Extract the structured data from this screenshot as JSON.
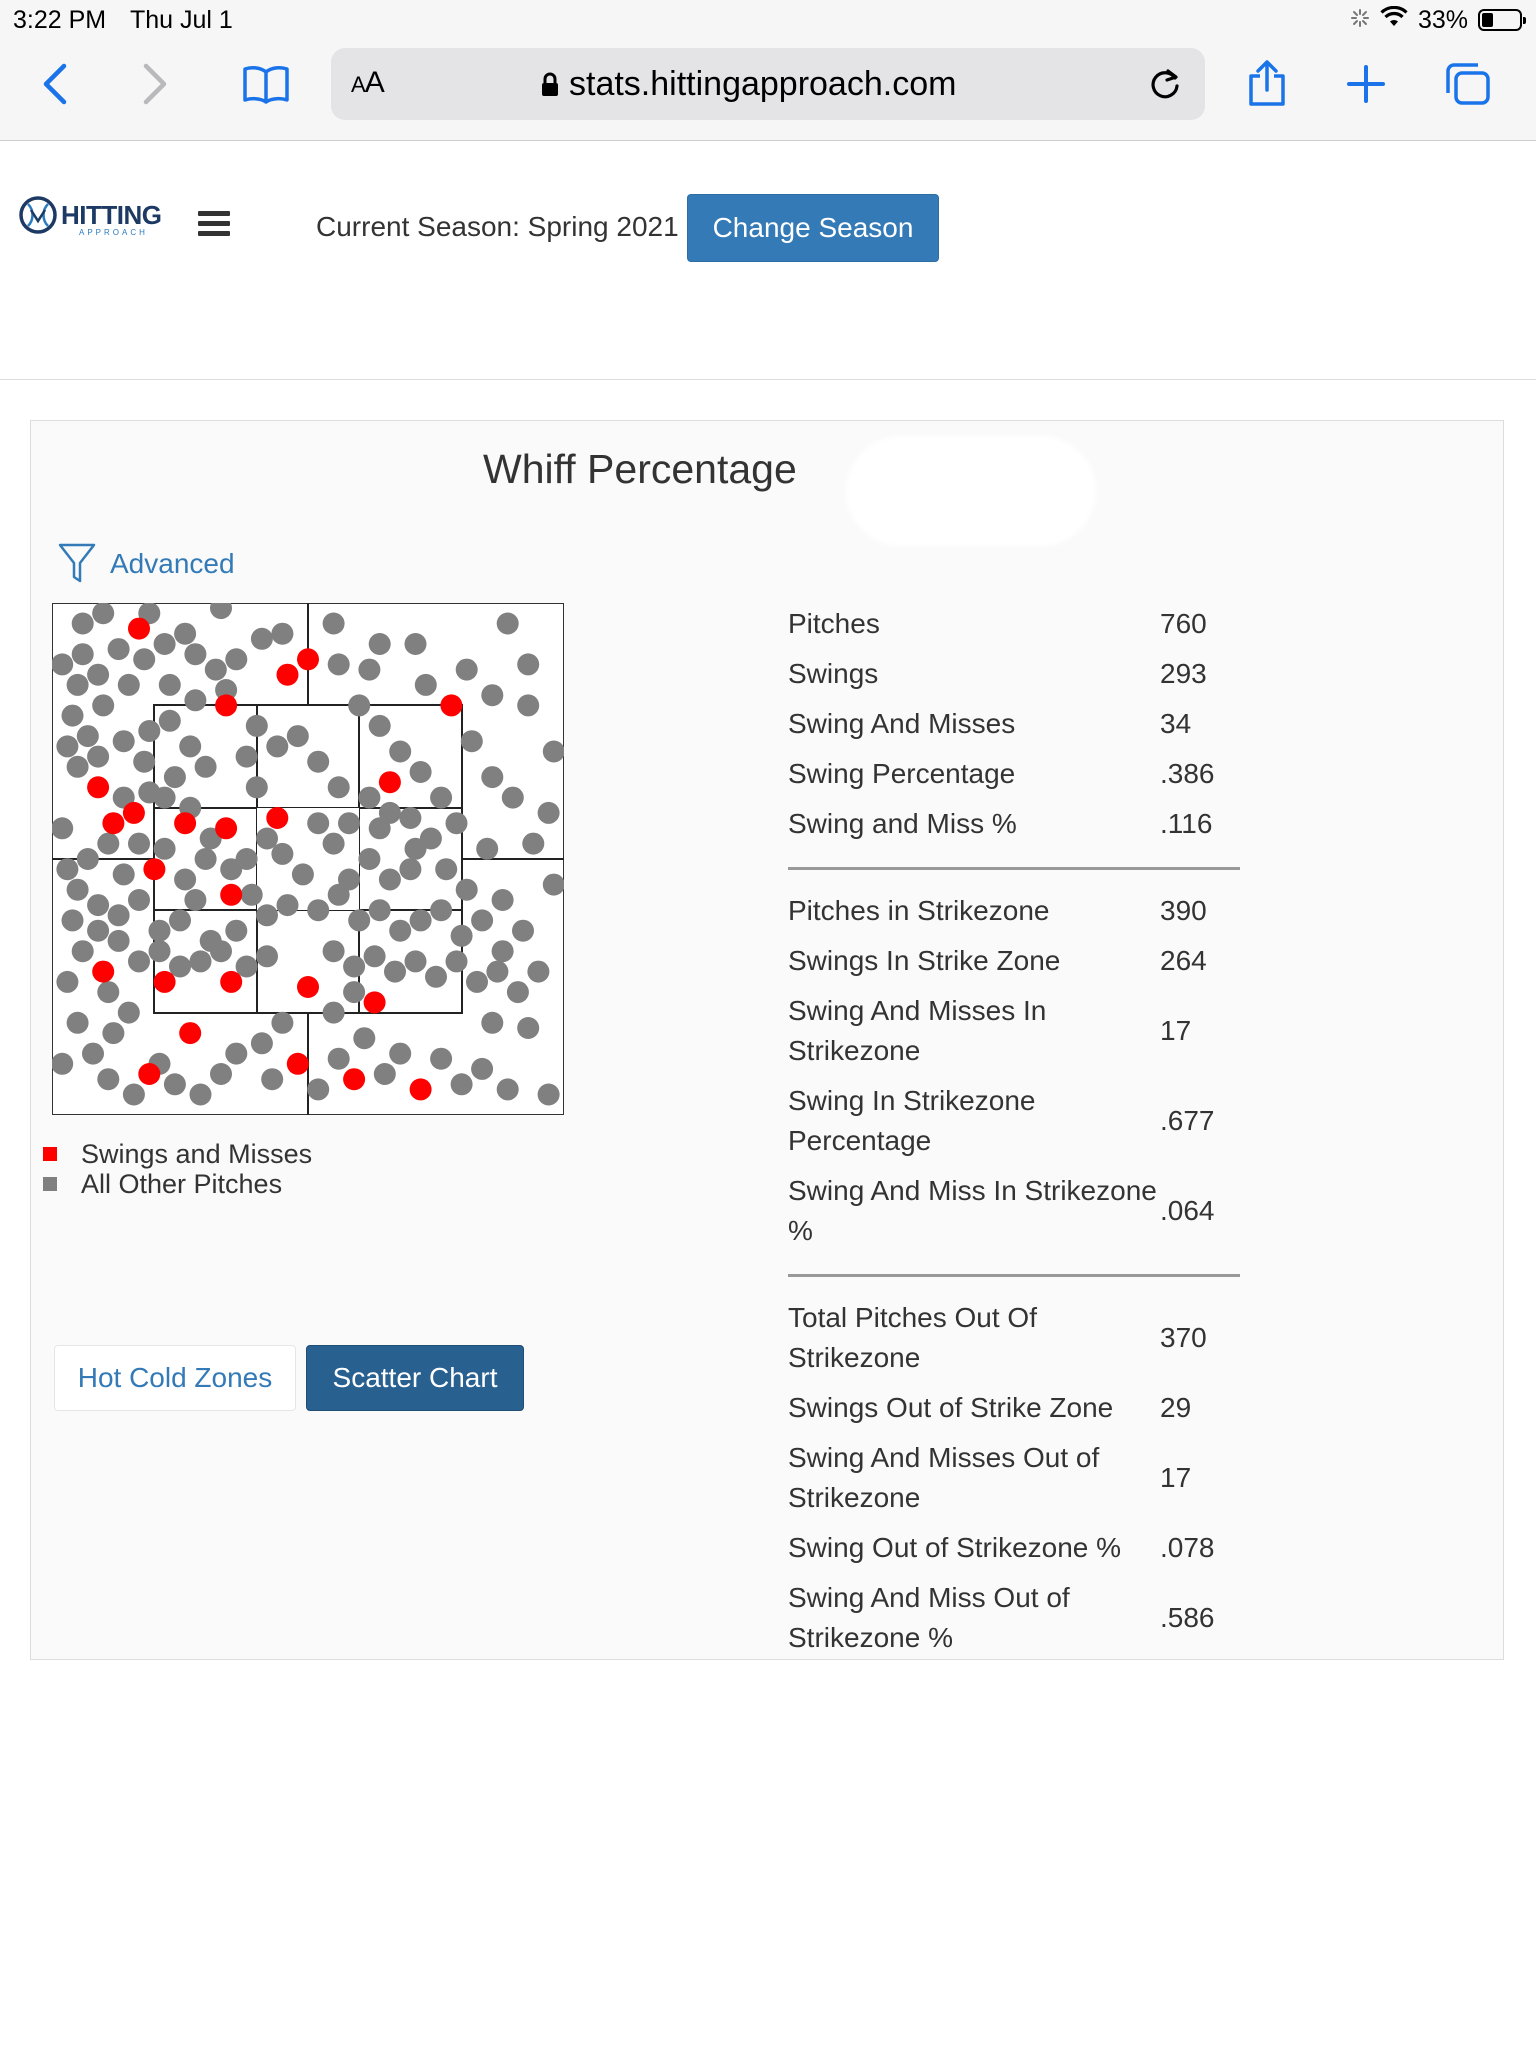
{
  "status_bar": {
    "time": "3:22 PM",
    "date": "Thu Jul 1",
    "battery": "33%"
  },
  "browser": {
    "text_size_label_small": "A",
    "text_size_label_large": "A",
    "url": "stats.hittingapproach.com"
  },
  "site": {
    "logo_text": "HITTING",
    "logo_subtext": "APPROACH",
    "season_text": "Current Season: Spring 2021",
    "change_season_label": "Change Season"
  },
  "panel": {
    "title": "Whiff Percentage",
    "advanced_label": "Advanced",
    "buttons": {
      "hot_cold": "Hot Cold Zones",
      "scatter": "Scatter Chart"
    }
  },
  "chart_data": {
    "type": "scatter",
    "legend": [
      "Swings and Misses",
      "All Other Pitches"
    ],
    "colors": {
      "swing_miss": "#ff0000",
      "other": "#808080"
    },
    "zone_grid": "3x3 strike zone inside 4 outer quadrants",
    "series": [
      {
        "name": "Swings and Misses",
        "points": [
          [
            0.17,
            0.05
          ],
          [
            0.5,
            0.11
          ],
          [
            0.46,
            0.14
          ],
          [
            0.78,
            0.2
          ],
          [
            0.34,
            0.2
          ],
          [
            0.09,
            0.36
          ],
          [
            0.16,
            0.41
          ],
          [
            0.12,
            0.43
          ],
          [
            0.26,
            0.43
          ],
          [
            0.34,
            0.44
          ],
          [
            0.44,
            0.42
          ],
          [
            0.66,
            0.35
          ],
          [
            0.2,
            0.52
          ],
          [
            0.35,
            0.57
          ],
          [
            0.1,
            0.72
          ],
          [
            0.22,
            0.74
          ],
          [
            0.35,
            0.74
          ],
          [
            0.5,
            0.75
          ],
          [
            0.63,
            0.78
          ],
          [
            0.27,
            0.84
          ],
          [
            0.19,
            0.92
          ],
          [
            0.48,
            0.9
          ],
          [
            0.59,
            0.93
          ],
          [
            0.72,
            0.95
          ]
        ]
      },
      {
        "name": "All Other Pitches",
        "points": [
          [
            0.06,
            0.04
          ],
          [
            0.1,
            0.02
          ],
          [
            0.19,
            0.02
          ],
          [
            0.26,
            0.06
          ],
          [
            0.33,
            0.01
          ],
          [
            0.45,
            0.06
          ],
          [
            0.55,
            0.04
          ],
          [
            0.64,
            0.08
          ],
          [
            0.71,
            0.08
          ],
          [
            0.89,
            0.04
          ],
          [
            0.93,
            0.12
          ],
          [
            0.81,
            0.13
          ],
          [
            0.86,
            0.18
          ],
          [
            0.93,
            0.2
          ],
          [
            0.98,
            0.29
          ],
          [
            0.06,
            0.1
          ],
          [
            0.09,
            0.14
          ],
          [
            0.13,
            0.09
          ],
          [
            0.18,
            0.11
          ],
          [
            0.22,
            0.08
          ],
          [
            0.28,
            0.1
          ],
          [
            0.32,
            0.13
          ],
          [
            0.36,
            0.11
          ],
          [
            0.41,
            0.07
          ],
          [
            0.56,
            0.12
          ],
          [
            0.62,
            0.13
          ],
          [
            0.73,
            0.16
          ],
          [
            0.04,
            0.22
          ],
          [
            0.07,
            0.26
          ],
          [
            0.05,
            0.32
          ],
          [
            0.09,
            0.3
          ],
          [
            0.14,
            0.27
          ],
          [
            0.19,
            0.25
          ],
          [
            0.23,
            0.23
          ],
          [
            0.27,
            0.28
          ],
          [
            0.3,
            0.32
          ],
          [
            0.24,
            0.34
          ],
          [
            0.19,
            0.37
          ],
          [
            0.14,
            0.38
          ],
          [
            0.11,
            0.47
          ],
          [
            0.07,
            0.5
          ],
          [
            0.05,
            0.56
          ],
          [
            0.09,
            0.59
          ],
          [
            0.13,
            0.61
          ],
          [
            0.17,
            0.58
          ],
          [
            0.21,
            0.64
          ],
          [
            0.25,
            0.62
          ],
          [
            0.28,
            0.58
          ],
          [
            0.31,
            0.66
          ],
          [
            0.36,
            0.64
          ],
          [
            0.39,
            0.57
          ],
          [
            0.42,
            0.61
          ],
          [
            0.46,
            0.59
          ],
          [
            0.52,
            0.6
          ],
          [
            0.56,
            0.57
          ],
          [
            0.6,
            0.62
          ],
          [
            0.64,
            0.6
          ],
          [
            0.68,
            0.64
          ],
          [
            0.72,
            0.62
          ],
          [
            0.76,
            0.6
          ],
          [
            0.8,
            0.65
          ],
          [
            0.84,
            0.62
          ],
          [
            0.88,
            0.68
          ],
          [
            0.92,
            0.64
          ],
          [
            0.95,
            0.72
          ],
          [
            0.13,
            0.66
          ],
          [
            0.17,
            0.7
          ],
          [
            0.21,
            0.68
          ],
          [
            0.25,
            0.71
          ],
          [
            0.29,
            0.7
          ],
          [
            0.33,
            0.68
          ],
          [
            0.38,
            0.71
          ],
          [
            0.42,
            0.69
          ],
          [
            0.55,
            0.68
          ],
          [
            0.59,
            0.71
          ],
          [
            0.63,
            0.69
          ],
          [
            0.67,
            0.72
          ],
          [
            0.71,
            0.7
          ],
          [
            0.75,
            0.73
          ],
          [
            0.79,
            0.7
          ],
          [
            0.83,
            0.74
          ],
          [
            0.87,
            0.72
          ],
          [
            0.91,
            0.76
          ],
          [
            0.6,
            0.2
          ],
          [
            0.64,
            0.24
          ],
          [
            0.68,
            0.29
          ],
          [
            0.72,
            0.33
          ],
          [
            0.76,
            0.38
          ],
          [
            0.7,
            0.42
          ],
          [
            0.74,
            0.46
          ],
          [
            0.64,
            0.44
          ],
          [
            0.62,
            0.5
          ],
          [
            0.66,
            0.54
          ],
          [
            0.7,
            0.52
          ],
          [
            0.56,
            0.36
          ],
          [
            0.52,
            0.31
          ],
          [
            0.48,
            0.26
          ],
          [
            0.44,
            0.28
          ],
          [
            0.4,
            0.24
          ],
          [
            0.38,
            0.3
          ],
          [
            0.4,
            0.36
          ],
          [
            0.42,
            0.46
          ],
          [
            0.38,
            0.5
          ],
          [
            0.3,
            0.5
          ],
          [
            0.26,
            0.54
          ],
          [
            0.22,
            0.48
          ],
          [
            0.17,
            0.47
          ],
          [
            0.14,
            0.53
          ],
          [
            0.09,
            0.64
          ],
          [
            0.06,
            0.68
          ],
          [
            0.11,
            0.76
          ],
          [
            0.15,
            0.8
          ],
          [
            0.12,
            0.84
          ],
          [
            0.08,
            0.88
          ],
          [
            0.11,
            0.93
          ],
          [
            0.16,
            0.96
          ],
          [
            0.21,
            0.9
          ],
          [
            0.24,
            0.94
          ],
          [
            0.29,
            0.96
          ],
          [
            0.33,
            0.92
          ],
          [
            0.36,
            0.88
          ],
          [
            0.41,
            0.86
          ],
          [
            0.45,
            0.82
          ],
          [
            0.43,
            0.93
          ],
          [
            0.52,
            0.95
          ],
          [
            0.56,
            0.89
          ],
          [
            0.61,
            0.85
          ],
          [
            0.65,
            0.92
          ],
          [
            0.68,
            0.88
          ],
          [
            0.76,
            0.89
          ],
          [
            0.8,
            0.94
          ],
          [
            0.84,
            0.91
          ],
          [
            0.89,
            0.95
          ],
          [
            0.97,
            0.96
          ],
          [
            0.55,
            0.8
          ],
          [
            0.59,
            0.76
          ],
          [
            0.86,
            0.82
          ],
          [
            0.93,
            0.83
          ],
          [
            0.98,
            0.55
          ],
          [
            0.94,
            0.47
          ],
          [
            0.9,
            0.38
          ],
          [
            0.86,
            0.34
          ],
          [
            0.82,
            0.27
          ],
          [
            0.97,
            0.41
          ],
          [
            0.34,
            0.17
          ],
          [
            0.28,
            0.19
          ],
          [
            0.23,
            0.16
          ],
          [
            0.15,
            0.16
          ],
          [
            0.1,
            0.2
          ],
          [
            0.05,
            0.16
          ],
          [
            0.02,
            0.12
          ],
          [
            0.03,
            0.28
          ],
          [
            0.02,
            0.44
          ],
          [
            0.03,
            0.52
          ],
          [
            0.04,
            0.62
          ],
          [
            0.03,
            0.74
          ],
          [
            0.05,
            0.82
          ],
          [
            0.02,
            0.9
          ],
          [
            0.18,
            0.31
          ],
          [
            0.22,
            0.38
          ],
          [
            0.27,
            0.4
          ],
          [
            0.31,
            0.46
          ],
          [
            0.35,
            0.52
          ],
          [
            0.45,
            0.49
          ],
          [
            0.49,
            0.53
          ],
          [
            0.55,
            0.47
          ],
          [
            0.58,
            0.43
          ],
          [
            0.62,
            0.38
          ],
          [
            0.66,
            0.41
          ],
          [
            0.71,
            0.48
          ],
          [
            0.77,
            0.52
          ],
          [
            0.81,
            0.56
          ],
          [
            0.85,
            0.48
          ],
          [
            0.88,
            0.58
          ],
          [
            0.79,
            0.43
          ],
          [
            0.58,
            0.54
          ],
          [
            0.52,
            0.43
          ]
        ]
      }
    ]
  },
  "stats_groups": [
    [
      {
        "label": "Pitches",
        "value": "760"
      },
      {
        "label": "Swings",
        "value": "293"
      },
      {
        "label": "Swing And Misses",
        "value": "34"
      },
      {
        "label": "Swing Percentage",
        "value": ".386"
      },
      {
        "label": "Swing and Miss %",
        "value": ".116"
      }
    ],
    [
      {
        "label": "Pitches in Strikezone",
        "value": "390"
      },
      {
        "label": "Swings In Strike Zone",
        "value": "264"
      },
      {
        "label": "Swing And Misses In Strikezone",
        "value": "17"
      },
      {
        "label": "Swing In Strikezone Percentage",
        "value": ".677"
      },
      {
        "label": "Swing And Miss In Strikezone %",
        "value": ".064"
      }
    ],
    [
      {
        "label": "Total Pitches Out Of Strikezone",
        "value": "370"
      },
      {
        "label": "Swings Out of Strike Zone",
        "value": "29"
      },
      {
        "label": "Swing And Misses Out of Strikezone",
        "value": "17"
      },
      {
        "label": "Swing Out of Strikezone %",
        "value": ".078"
      },
      {
        "label": "Swing And Miss Out of Strikezone %",
        "value": ".586"
      }
    ]
  ]
}
